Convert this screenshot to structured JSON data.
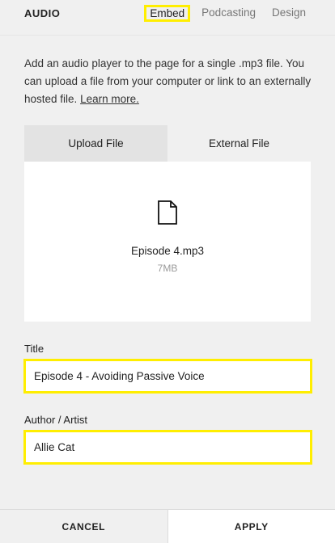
{
  "header": {
    "title": "AUDIO",
    "tabs": [
      {
        "label": "Embed",
        "active": true
      },
      {
        "label": "Podcasting",
        "active": false
      },
      {
        "label": "Design",
        "active": false
      }
    ]
  },
  "description": {
    "text": "Add an audio player to the page for a single .mp3 file. You can upload a file from your computer or link to an externally hosted file.",
    "link_label": "Learn more."
  },
  "upload": {
    "tabs": [
      {
        "label": "Upload File",
        "active": true
      },
      {
        "label": "External File",
        "active": false
      }
    ],
    "file": {
      "icon": "file-icon",
      "name": "Episode 4.mp3",
      "size": "7MB"
    }
  },
  "fields": {
    "title": {
      "label": "Title",
      "value": "Episode 4 - Avoiding Passive Voice"
    },
    "author": {
      "label": "Author / Artist",
      "value": "Allie Cat"
    }
  },
  "footer": {
    "cancel_label": "CANCEL",
    "apply_label": "APPLY"
  },
  "colors": {
    "highlight": "#ffee00",
    "panel_bg": "#f0f0f0",
    "active_tab_bg": "#e3e3e3"
  }
}
